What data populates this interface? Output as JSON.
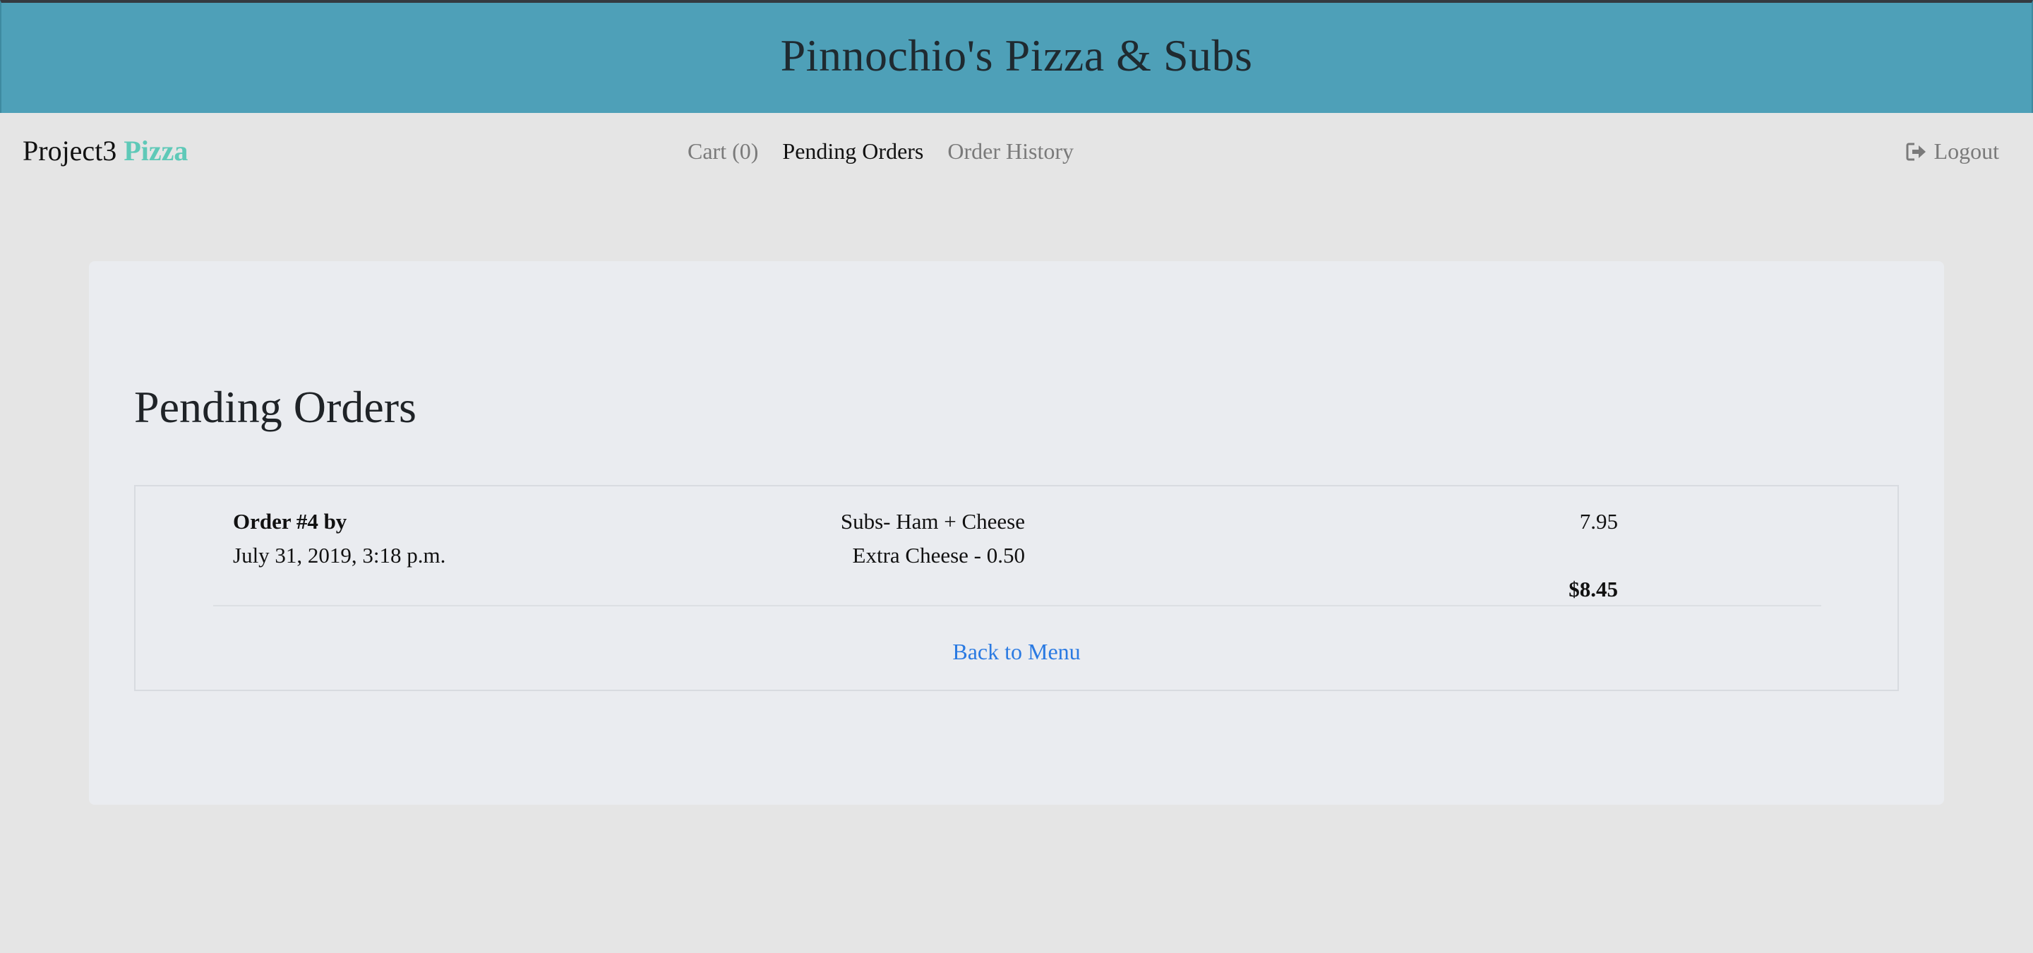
{
  "banner": {
    "title": "Pinnochio's Pizza & Subs"
  },
  "navbar": {
    "brand_prefix": "Project3",
    "brand_accent": "Pizza",
    "links": [
      {
        "label": "Cart (0)",
        "active": false
      },
      {
        "label": "Pending Orders",
        "active": true
      },
      {
        "label": "Order History",
        "active": false
      }
    ],
    "logout_label": "Logout",
    "logout_icon": "sign-out-icon"
  },
  "main": {
    "title": "Pending Orders",
    "orders": [
      {
        "heading": "Order #4 by",
        "timestamp": "July 31, 2019, 3:18 p.m.",
        "items": [
          {
            "name": "Subs- Ham + Cheese",
            "price": "7.95"
          },
          {
            "name": "Extra Cheese - 0.50"
          }
        ],
        "total": "$8.45"
      }
    ],
    "back_link": "Back to Menu"
  },
  "colors": {
    "banner": "#4ea0b8",
    "brand_accent": "#5fc9b8",
    "link": "#2a7ae2",
    "page_background": "#e5e5e5",
    "card_background": "#eaecf0"
  }
}
